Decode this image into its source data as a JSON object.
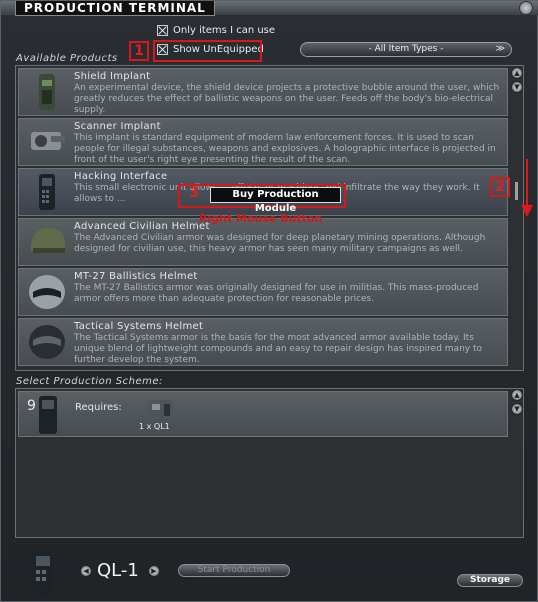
{
  "window": {
    "title": "PRODUCTION TERMINAL"
  },
  "filters": {
    "only_items_label": "Only items I can use",
    "show_unequipped_label": "Show UnEquipped",
    "item_types_label": "- All Item Types -"
  },
  "sections": {
    "available_products": "Available Products",
    "select_scheme": "Select Production Scheme:"
  },
  "products": [
    {
      "name": "Shield Implant",
      "desc": "An experimental device, the shield device projects a protective bubble around the user, which greatly reduces the effect of ballistic weapons on the user. Feeds off the body's bio-electrical supply."
    },
    {
      "name": "Scanner Implant",
      "desc": "This implant is standard equipment of modern law enforcement forces. It is used to scan people for illegal substances, weapons and explosives. A holographic interface is projected in front of the user's right eye presenting the result of the scan."
    },
    {
      "name": "Hacking Interface",
      "desc": "This small electronic unit allows ... effects or machines and infiltrate the way they work. It allows to ..."
    },
    {
      "name": "Advanced Civilian Helmet",
      "desc": "The Advanced Civilian armor was designed for deep planetary mining operations. Although designed for civilian use, this heavy armor has seen many military campaigns as well."
    },
    {
      "name": "MT-27 Ballistics Helmet",
      "desc": "The MT-27 Ballistics armor was originally designed for use in militias. This mass-produced armor offers more than adequate protection for reasonable prices."
    },
    {
      "name": "Tactical Systems Helmet",
      "desc": "The Tactical Systems armor is the basis for the most advanced armor available today. Its unique blend of lightweight compounds and an easy to repair design has inspired many to further develop the system."
    }
  ],
  "context_menu": {
    "label": "Buy Production Module",
    "note": "Right Mouse Button"
  },
  "annotations": {
    "n1": "1",
    "n2": "2",
    "n3": "3"
  },
  "scheme": {
    "count": "9",
    "requires_label": "Requires:",
    "item_label": "1 x QL1"
  },
  "bottom": {
    "level": "QL-1",
    "start_label": "Start Production",
    "storage_label": "Storage"
  },
  "colors": {
    "highlight_red": "#d81818",
    "panel_bg": "#2c3033"
  }
}
